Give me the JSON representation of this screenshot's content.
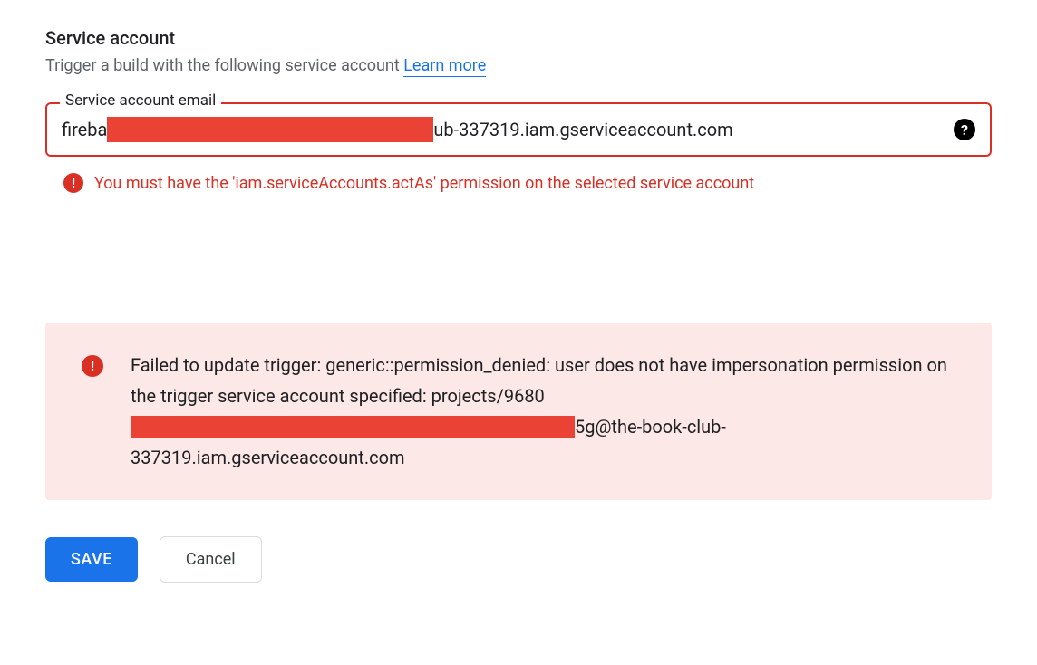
{
  "section": {
    "title": "Service account",
    "subtitle": "Trigger a build with the following service account ",
    "learn_more": "Learn more"
  },
  "field": {
    "label": "Service account email",
    "value_prefix": "fireba",
    "value_suffix": "ub-337319.iam.gserviceaccount.com",
    "error_message": "You must have the 'iam.serviceAccounts.actAs' permission on the selected service account"
  },
  "banner": {
    "message_prefix": "Failed to update trigger: generic::permission_denied: user does not have impersonation permission on the trigger service account specified: projects/9680",
    "message_suffix": "5g@the-book-club-337319.iam.gserviceaccount.com"
  },
  "buttons": {
    "save": "SAVE",
    "cancel": "Cancel"
  }
}
